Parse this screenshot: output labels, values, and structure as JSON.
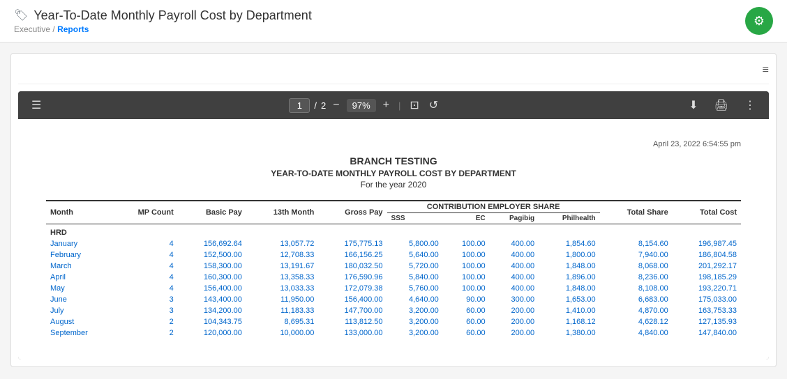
{
  "header": {
    "title": "Year-To-Date Monthly Payroll Cost by Department",
    "tag_icon": "🏷",
    "breadcrumb_parent": "Executive",
    "breadcrumb_separator": "/",
    "breadcrumb_current": "Reports",
    "gear_icon": "⚙"
  },
  "toolbar": {
    "menu_icon": "☰",
    "current_page": "1",
    "total_pages": "2",
    "separator1": "/",
    "minus_icon": "−",
    "zoom": "97%",
    "plus_icon": "+",
    "separator2": "|",
    "fit_icon": "⊡",
    "rotate_icon": "↺",
    "separator3": "|",
    "download_icon": "⬇",
    "print_icon": "🖨",
    "more_icon": "⋮"
  },
  "report": {
    "timestamp": "April 23, 2022   6:54:55 pm",
    "company": "BRANCH TESTING",
    "title": "YEAR-TO-DATE MONTHLY PAYROLL COST BY DEPARTMENT",
    "period": "For the year 2020",
    "contribution_header": "CONTRIBUTION EMPLOYER SHARE",
    "columns": {
      "month": "Month",
      "mp_count": "MP Count",
      "basic_pay": "Basic Pay",
      "thirteenth": "13th Month",
      "gross_pay": "Gross Pay",
      "sss": "SSS",
      "ec": "EC",
      "pagibig": "Pagibig",
      "philhealth": "Philhealth",
      "total_share": "Total Share",
      "total_cost": "Total Cost"
    },
    "section_hrd": "HRD",
    "rows": [
      {
        "month": "January",
        "mp": "4",
        "basic": "156,692.64",
        "thirteenth": "13,057.72",
        "gross": "175,775.13",
        "sss": "5,800.00",
        "ec": "100.00",
        "pagibig": "400.00",
        "phil": "1,854.60",
        "total_share": "8,154.60",
        "total_cost": "196,987.45"
      },
      {
        "month": "February",
        "mp": "4",
        "basic": "152,500.00",
        "thirteenth": "12,708.33",
        "gross": "166,156.25",
        "sss": "5,640.00",
        "ec": "100.00",
        "pagibig": "400.00",
        "phil": "1,800.00",
        "total_share": "7,940.00",
        "total_cost": "186,804.58"
      },
      {
        "month": "March",
        "mp": "4",
        "basic": "158,300.00",
        "thirteenth": "13,191.67",
        "gross": "180,032.50",
        "sss": "5,720.00",
        "ec": "100.00",
        "pagibig": "400.00",
        "phil": "1,848.00",
        "total_share": "8,068.00",
        "total_cost": "201,292.17"
      },
      {
        "month": "April",
        "mp": "4",
        "basic": "160,300.00",
        "thirteenth": "13,358.33",
        "gross": "176,590.96",
        "sss": "5,840.00",
        "ec": "100.00",
        "pagibig": "400.00",
        "phil": "1,896.00",
        "total_share": "8,236.00",
        "total_cost": "198,185.29"
      },
      {
        "month": "May",
        "mp": "4",
        "basic": "156,400.00",
        "thirteenth": "13,033.33",
        "gross": "172,079.38",
        "sss": "5,760.00",
        "ec": "100.00",
        "pagibig": "400.00",
        "phil": "1,848.00",
        "total_share": "8,108.00",
        "total_cost": "193,220.71"
      },
      {
        "month": "June",
        "mp": "3",
        "basic": "143,400.00",
        "thirteenth": "11,950.00",
        "gross": "156,400.00",
        "sss": "4,640.00",
        "ec": "90.00",
        "pagibig": "300.00",
        "phil": "1,653.00",
        "total_share": "6,683.00",
        "total_cost": "175,033.00"
      },
      {
        "month": "July",
        "mp": "3",
        "basic": "134,200.00",
        "thirteenth": "11,183.33",
        "gross": "147,700.00",
        "sss": "3,200.00",
        "ec": "60.00",
        "pagibig": "200.00",
        "phil": "1,410.00",
        "total_share": "4,870.00",
        "total_cost": "163,753.33"
      },
      {
        "month": "August",
        "mp": "2",
        "basic": "104,343.75",
        "thirteenth": "8,695.31",
        "gross": "113,812.50",
        "sss": "3,200.00",
        "ec": "60.00",
        "pagibig": "200.00",
        "phil": "1,168.12",
        "total_share": "4,628.12",
        "total_cost": "127,135.93"
      },
      {
        "month": "September",
        "mp": "2",
        "basic": "120,000.00",
        "thirteenth": "10,000.00",
        "gross": "133,000.00",
        "sss": "3,200.00",
        "ec": "60.00",
        "pagibig": "200.00",
        "phil": "1,380.00",
        "total_share": "4,840.00",
        "total_cost": "147,840.00"
      }
    ]
  },
  "filter_icon_label": "≡"
}
